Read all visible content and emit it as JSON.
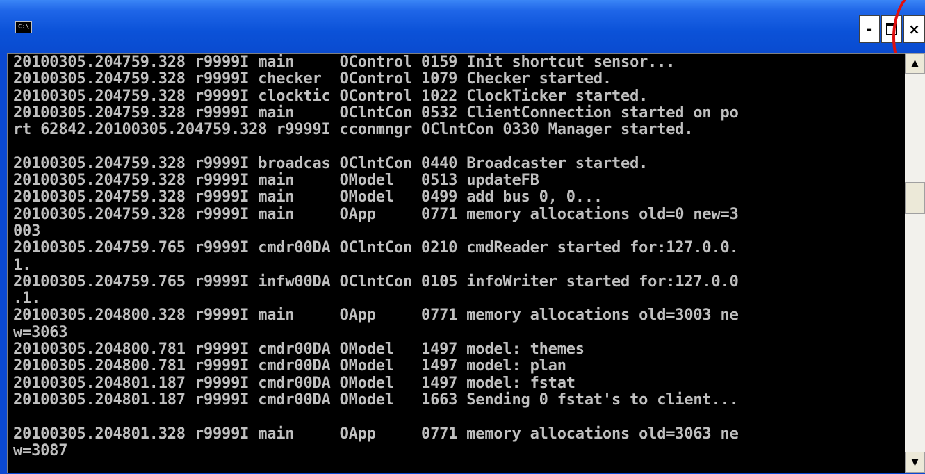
{
  "window": {
    "icon_label": "C:\\",
    "buttons": {
      "minimize": "-",
      "maximize": "",
      "close": "×"
    }
  },
  "console": {
    "lines": [
      "20100305.204759.328 r9999I main     OControl 0159 Init shortcut sensor...",
      "20100305.204759.328 r9999I checker  OControl 1079 Checker started.",
      "20100305.204759.328 r9999I clocktic OControl 1022 ClockTicker started.",
      "20100305.204759.328 r9999I main     OClntCon 0532 ClientConnection started on po",
      "rt 62842.20100305.204759.328 r9999I cconmngr OClntCon 0330 Manager started.",
      "",
      "20100305.204759.328 r9999I broadcas OClntCon 0440 Broadcaster started.",
      "20100305.204759.328 r9999I main     OModel   0513 updateFB",
      "20100305.204759.328 r9999I main     OModel   0499 add bus 0, 0...",
      "20100305.204759.328 r9999I main     OApp     0771 memory allocations old=0 new=3",
      "003",
      "20100305.204759.765 r9999I cmdr00DA OClntCon 0210 cmdReader started for:127.0.0.",
      "1.",
      "20100305.204759.765 r9999I infw00DA OClntCon 0105 infoWriter started for:127.0.0",
      ".1.",
      "20100305.204800.328 r9999I main     OApp     0771 memory allocations old=3003 ne",
      "w=3063",
      "20100305.204800.781 r9999I cmdr00DA OModel   1497 model: themes",
      "20100305.204800.781 r9999I cmdr00DA OModel   1497 model: plan",
      "20100305.204801.187 r9999I cmdr00DA OModel   1497 model: fstat",
      "20100305.204801.187 r9999I cmdr00DA OModel   1663 Sending 0 fstat's to client...",
      "",
      "20100305.204801.328 r9999I main     OApp     0771 memory allocations old=3063 ne",
      "w=3087"
    ]
  },
  "scrollbar": {
    "up_arrow": "▲",
    "down_arrow": "▼"
  }
}
